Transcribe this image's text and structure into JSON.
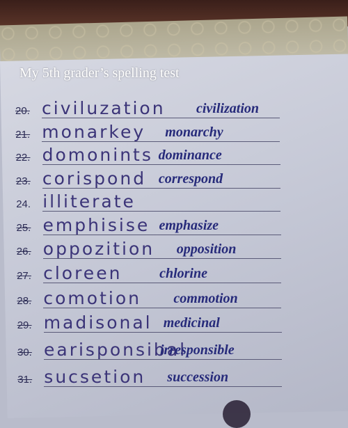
{
  "caption": "My 5th grader’s spelling test",
  "rows": [
    {
      "num": "20.",
      "attempt": "civiluzation",
      "correction": "civilization",
      "crossed": true
    },
    {
      "num": "21.",
      "attempt": "monarkey",
      "correction": "monarchy",
      "crossed": true
    },
    {
      "num": "22.",
      "attempt": "domonints",
      "correction": "dominance",
      "crossed": true
    },
    {
      "num": "23.",
      "attempt": "corispond",
      "correction": "correspond",
      "crossed": true
    },
    {
      "num": "24.",
      "attempt": "illiterate",
      "correction": "",
      "crossed": false
    },
    {
      "num": "25.",
      "attempt": "emphisise",
      "correction": "emphasize",
      "crossed": true
    },
    {
      "num": "26.",
      "attempt": "oppozition",
      "correction": "opposition",
      "crossed": true
    },
    {
      "num": "27.",
      "attempt": "cloreen",
      "correction": "chlorine",
      "crossed": true
    },
    {
      "num": "28.",
      "attempt": "comotion",
      "correction": "commotion",
      "crossed": true
    },
    {
      "num": "29.",
      "attempt": "madisonal",
      "correction": "medicinal",
      "crossed": true
    },
    {
      "num": "30.",
      "attempt": "earisponsibal",
      "correction": "irresponsible",
      "crossed": true
    },
    {
      "num": "31.",
      "attempt": "sucsetion",
      "correction": "succession",
      "crossed": true
    }
  ]
}
